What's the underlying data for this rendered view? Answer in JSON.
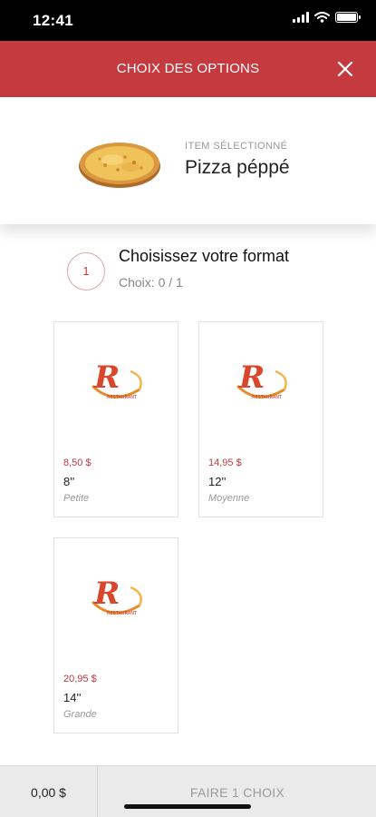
{
  "status_bar": {
    "time": "12:41",
    "icons": [
      "signal-icon",
      "wifi-icon",
      "battery-icon"
    ]
  },
  "header": {
    "title": "CHOIX DES OPTIONS",
    "close_icon": "close-icon"
  },
  "item": {
    "label": "ITEM SÉLECTIONNÉ",
    "name": "Pizza péppé"
  },
  "step": {
    "number": "1",
    "title": "Choisissez votre format",
    "subtitle": "Choix: 0 / 1"
  },
  "options": [
    {
      "price": "8,50 $",
      "size": "8''",
      "name": "Petite"
    },
    {
      "price": "14,95 $",
      "size": "12''",
      "name": "Moyenne"
    },
    {
      "price": "20,95 $",
      "size": "14''",
      "name": "Grande"
    }
  ],
  "footer": {
    "total": "0,00 $",
    "action": "FAIRE 1 CHOIX"
  },
  "colors": {
    "brand_red": "#c53a3f",
    "price_red": "#c53a3f",
    "muted_gray": "#999999"
  }
}
